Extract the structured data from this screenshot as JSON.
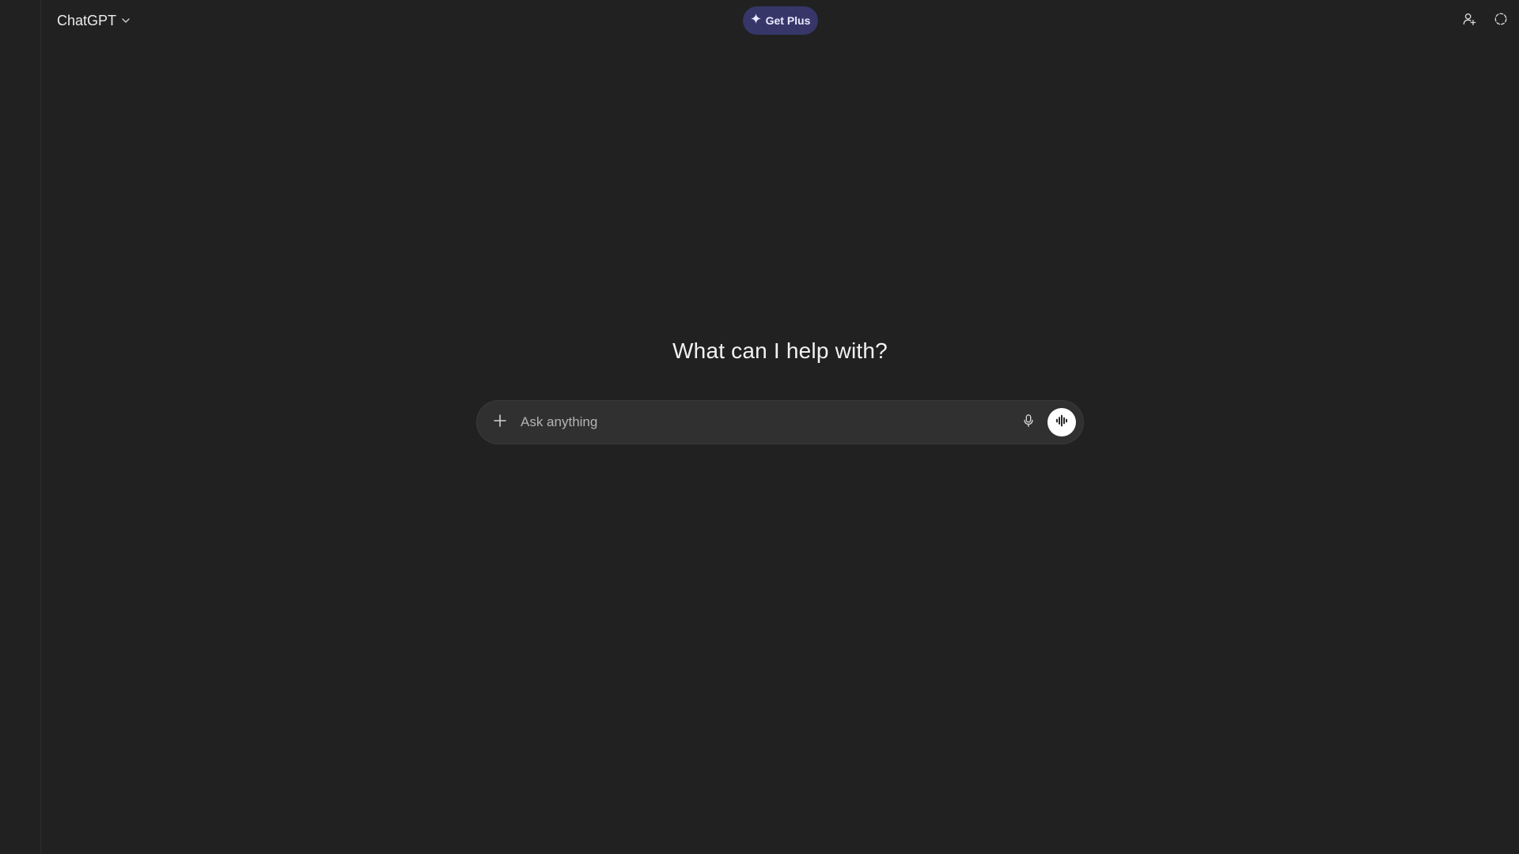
{
  "app": {
    "model_label": "ChatGPT"
  },
  "topbar": {
    "upgrade_label": "Get Plus",
    "icons": {
      "upgrade": "sparkle-icon",
      "model_chevron": "chevron-down-icon",
      "share": "add-person-icon",
      "temporary": "temporary-chat-icon"
    }
  },
  "main": {
    "headline": "What can I help with?"
  },
  "composer": {
    "placeholder": "Ask anything",
    "value": "",
    "icons": {
      "attach": "plus-icon",
      "dictate": "microphone-icon",
      "voice": "voice-waveform-icon"
    }
  },
  "colors": {
    "background": "#212121",
    "composer": "#303030",
    "upgrade_pill": "#373669",
    "voice_button": "#ffffff"
  }
}
